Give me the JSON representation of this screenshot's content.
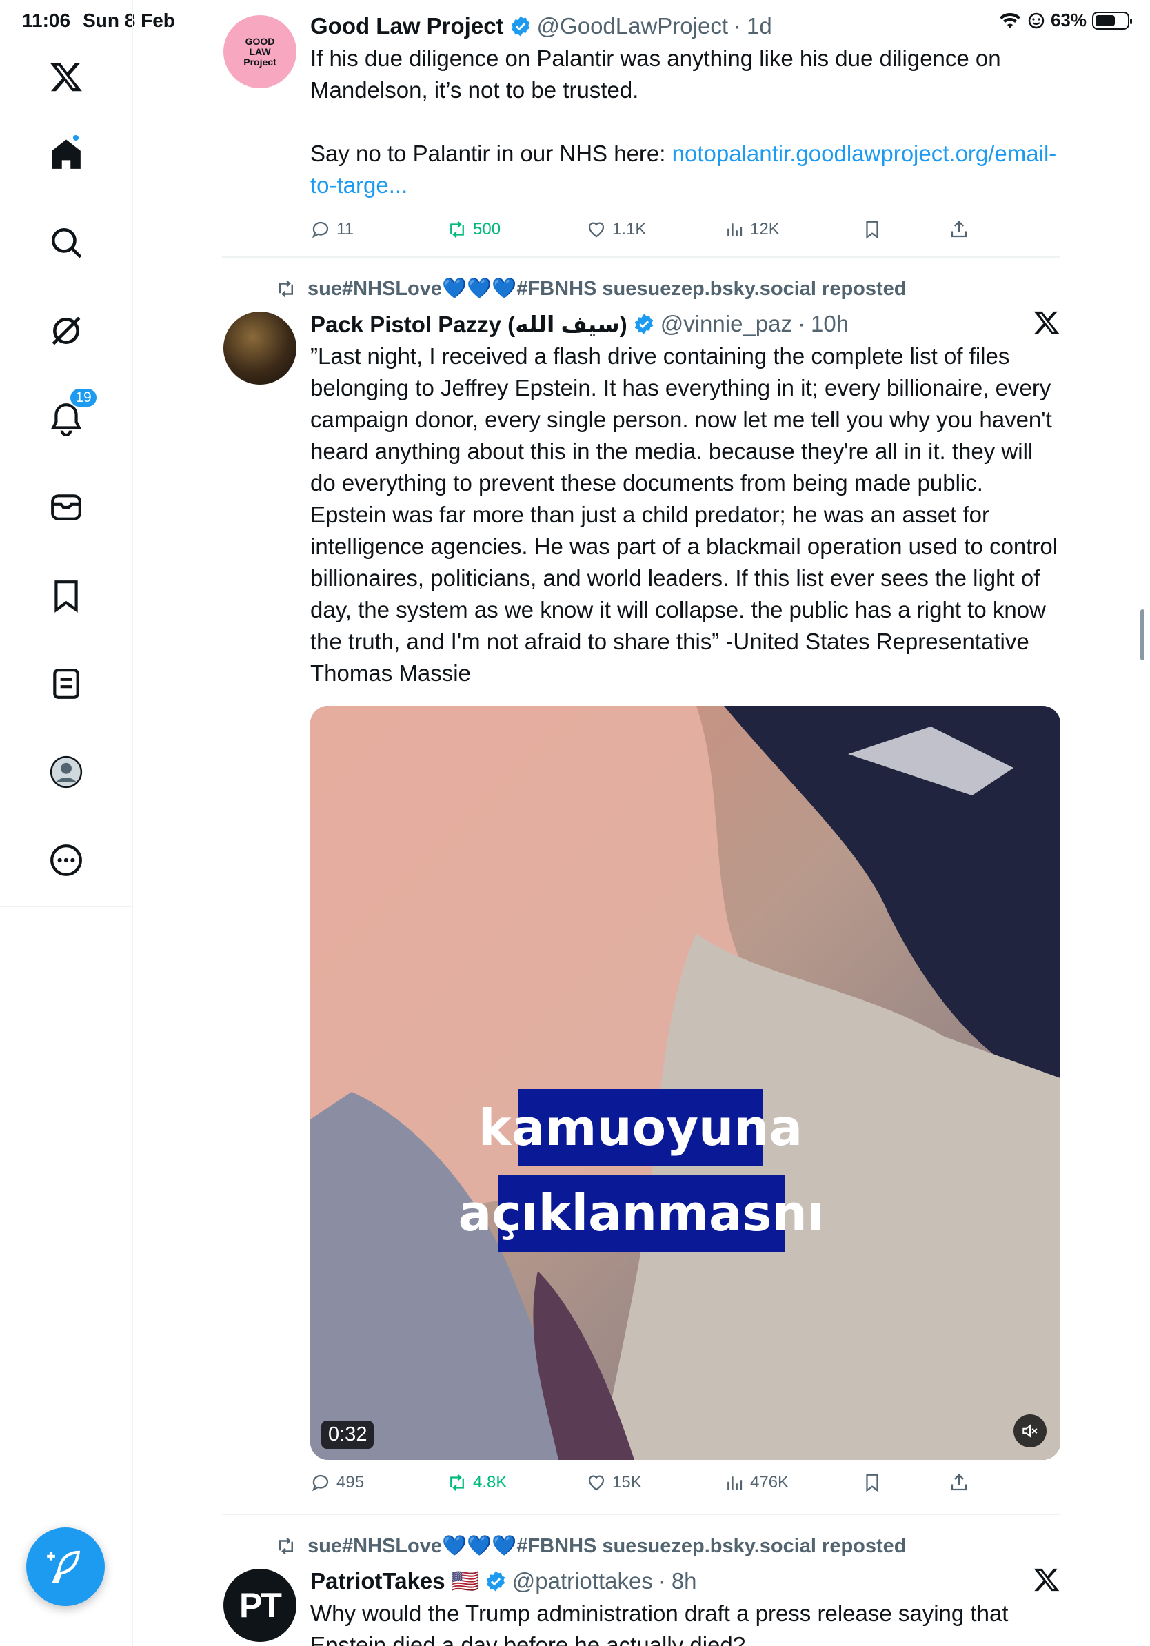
{
  "status_bar": {
    "time": "11:06",
    "date": "Sun 8 Feb",
    "battery": "63%",
    "battery_level": 0.63
  },
  "sidebar": {
    "notifications_badge": "19",
    "icons": [
      "x-logo-icon",
      "home-icon",
      "search-icon",
      "grok-icon",
      "notifications-icon",
      "messages-icon",
      "bookmarks-icon",
      "lists-icon",
      "profile-icon",
      "more-icon"
    ]
  },
  "colors": {
    "accent": "#1d9bf0",
    "repost_green": "#00ba7c",
    "secondary_text": "#536471",
    "caption_bg": "#0a1a96"
  },
  "tweets": [
    {
      "display_name": "Good Law Project",
      "handle": "@GoodLawProject",
      "time": "1d",
      "avatar_text": "GOOD LAW Project",
      "text_p1": "If his due diligence on Palantir was anything like his due diligence on Mandelson, it’s not to be trusted.",
      "text_p2_prefix": "Say no to Palantir in our NHS here: ",
      "link": "notopalantir.goodlawproject.org/email-to-targe...",
      "replies": "11",
      "reposts": "500",
      "likes": "1.1K",
      "views": "12K"
    },
    {
      "reposted_by": "sue#NHSLove💙💙💙#FBNHS suesuezep.bsky.social reposted",
      "display_name": "Pack Pistol Pazzy (سيف الله)",
      "handle": "@vinnie_paz",
      "time": "10h",
      "text": "”Last night, I received a flash drive containing the complete list of files belonging to Jeffrey Epstein. It has everything in it; every billionaire, every campaign donor, every single person. now let me tell you why you haven't heard anything about this in the media. because they're all in it. they will do everything to prevent these documents from being made public. Epstein was far more than just a child predator; he was an asset for intelligence agencies. He was part of a blackmail operation used to control billionaires, politicians, and world leaders. If this list ever sees the light of day, the system as we know it will collapse. the public has a right to know the truth, and I'm not afraid to share this” -United States Representative Thomas Massie",
      "video_caption_1": "kamuoyuna",
      "video_caption_2": "açıklanmasnı",
      "video_duration": "0:32",
      "replies": "495",
      "reposts": "4.8K",
      "likes": "15K",
      "views": "476K"
    },
    {
      "reposted_by": "sue#NHSLove💙💙💙#FBNHS suesuezep.bsky.social reposted",
      "display_name": "PatriotTakes",
      "flag": "🇺🇸",
      "handle": "@patriottakes",
      "time": "8h",
      "avatar_text": "PT",
      "text": "Why would the Trump administration draft a press release saying that Epstein died a day before he actually died?"
    }
  ]
}
